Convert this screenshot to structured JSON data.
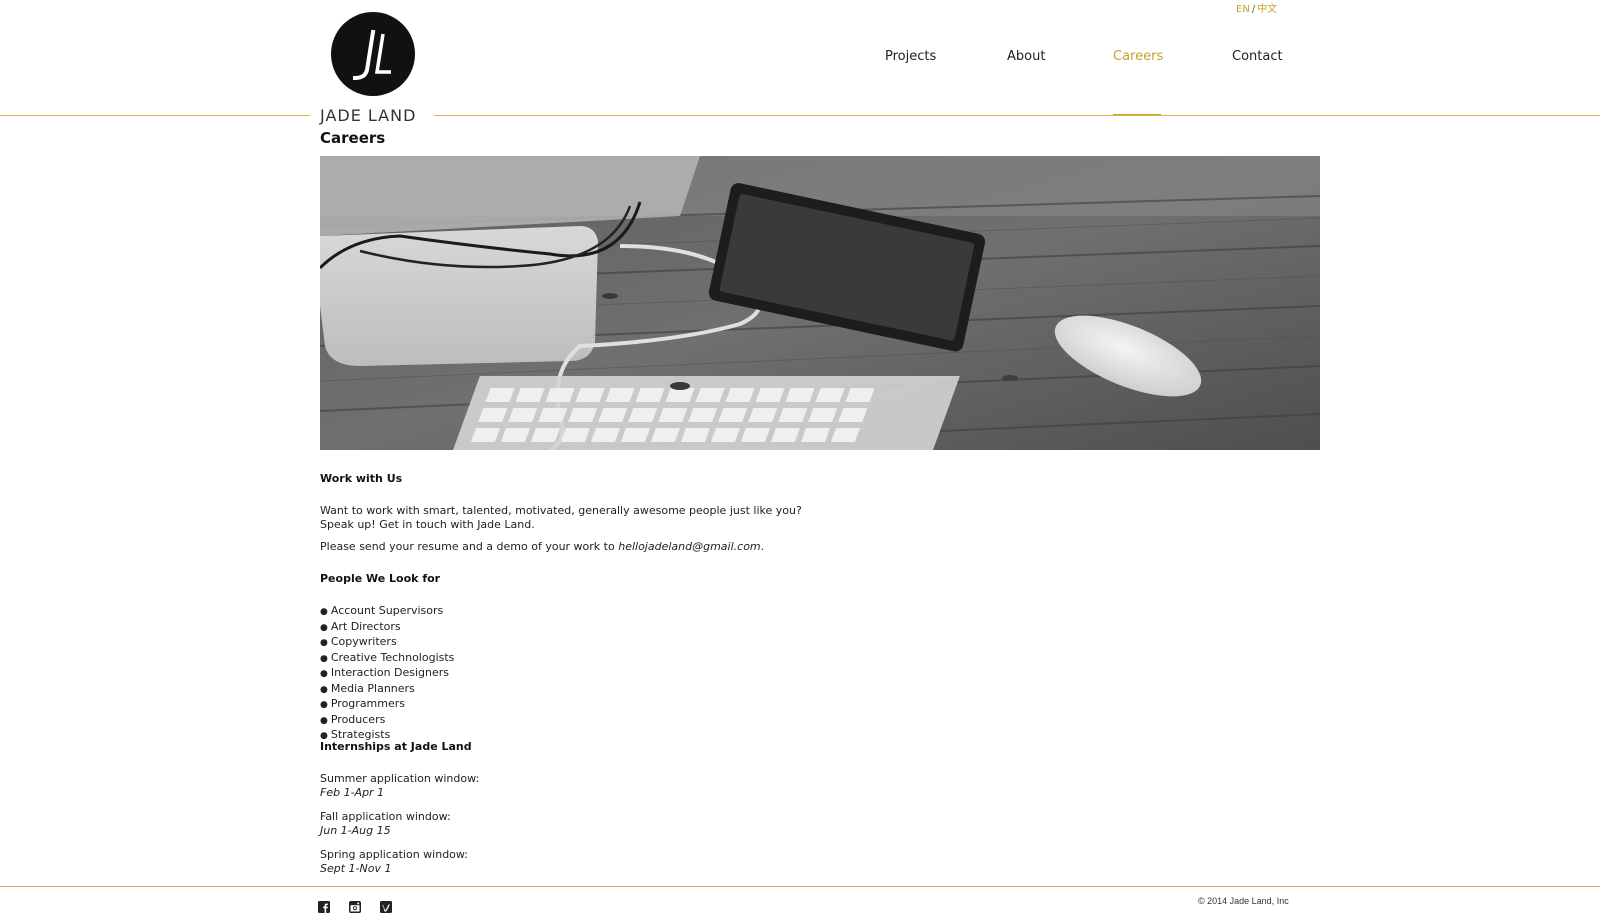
{
  "header": {
    "lang": {
      "en": "EN",
      "separator": "/",
      "zh": "中文"
    },
    "logo": {
      "mark": "JL",
      "text": "JADE LAND"
    },
    "nav": [
      {
        "label": "Projects"
      },
      {
        "label": "About"
      },
      {
        "label": "Careers",
        "active": true
      },
      {
        "label": "Contact"
      }
    ]
  },
  "main": {
    "title": "Careers",
    "hero_image": "desk-workspace-photo",
    "work": {
      "heading": "Work with Us",
      "line1": "Want to work with smart, talented, motivated, generally awesome people just like you?",
      "line2": "Speak up! Get in touch with Jade Land.",
      "send_prefix": "Please send your resume and a demo of your work to ",
      "email": "hellojadeland@gmail.com",
      "send_suffix": "."
    },
    "people": {
      "heading": "People We Look for",
      "items": [
        "Account Supervisors",
        "Art Directors",
        "Copywriters",
        "Creative Technologists",
        "Interaction Designers",
        "Media Planners",
        "Programmers",
        "Producers",
        "Strategists"
      ]
    },
    "internships": {
      "heading": "Internships at Jade Land",
      "windows": [
        {
          "label": "Summer application window:",
          "dates": "Feb 1-Apr 1"
        },
        {
          "label": "Fall application window:",
          "dates": "Jun 1-Aug 15"
        },
        {
          "label": "Spring application window:",
          "dates": "Sept 1-Nov 1"
        }
      ]
    }
  },
  "footer": {
    "social": [
      "facebook-icon",
      "instagram-icon",
      "vimeo-icon"
    ],
    "copyright": "© 2014 Jade Land, Inc"
  },
  "colors": {
    "accent": "#c9a227",
    "line": "#d8b24a",
    "text": "#222222"
  }
}
